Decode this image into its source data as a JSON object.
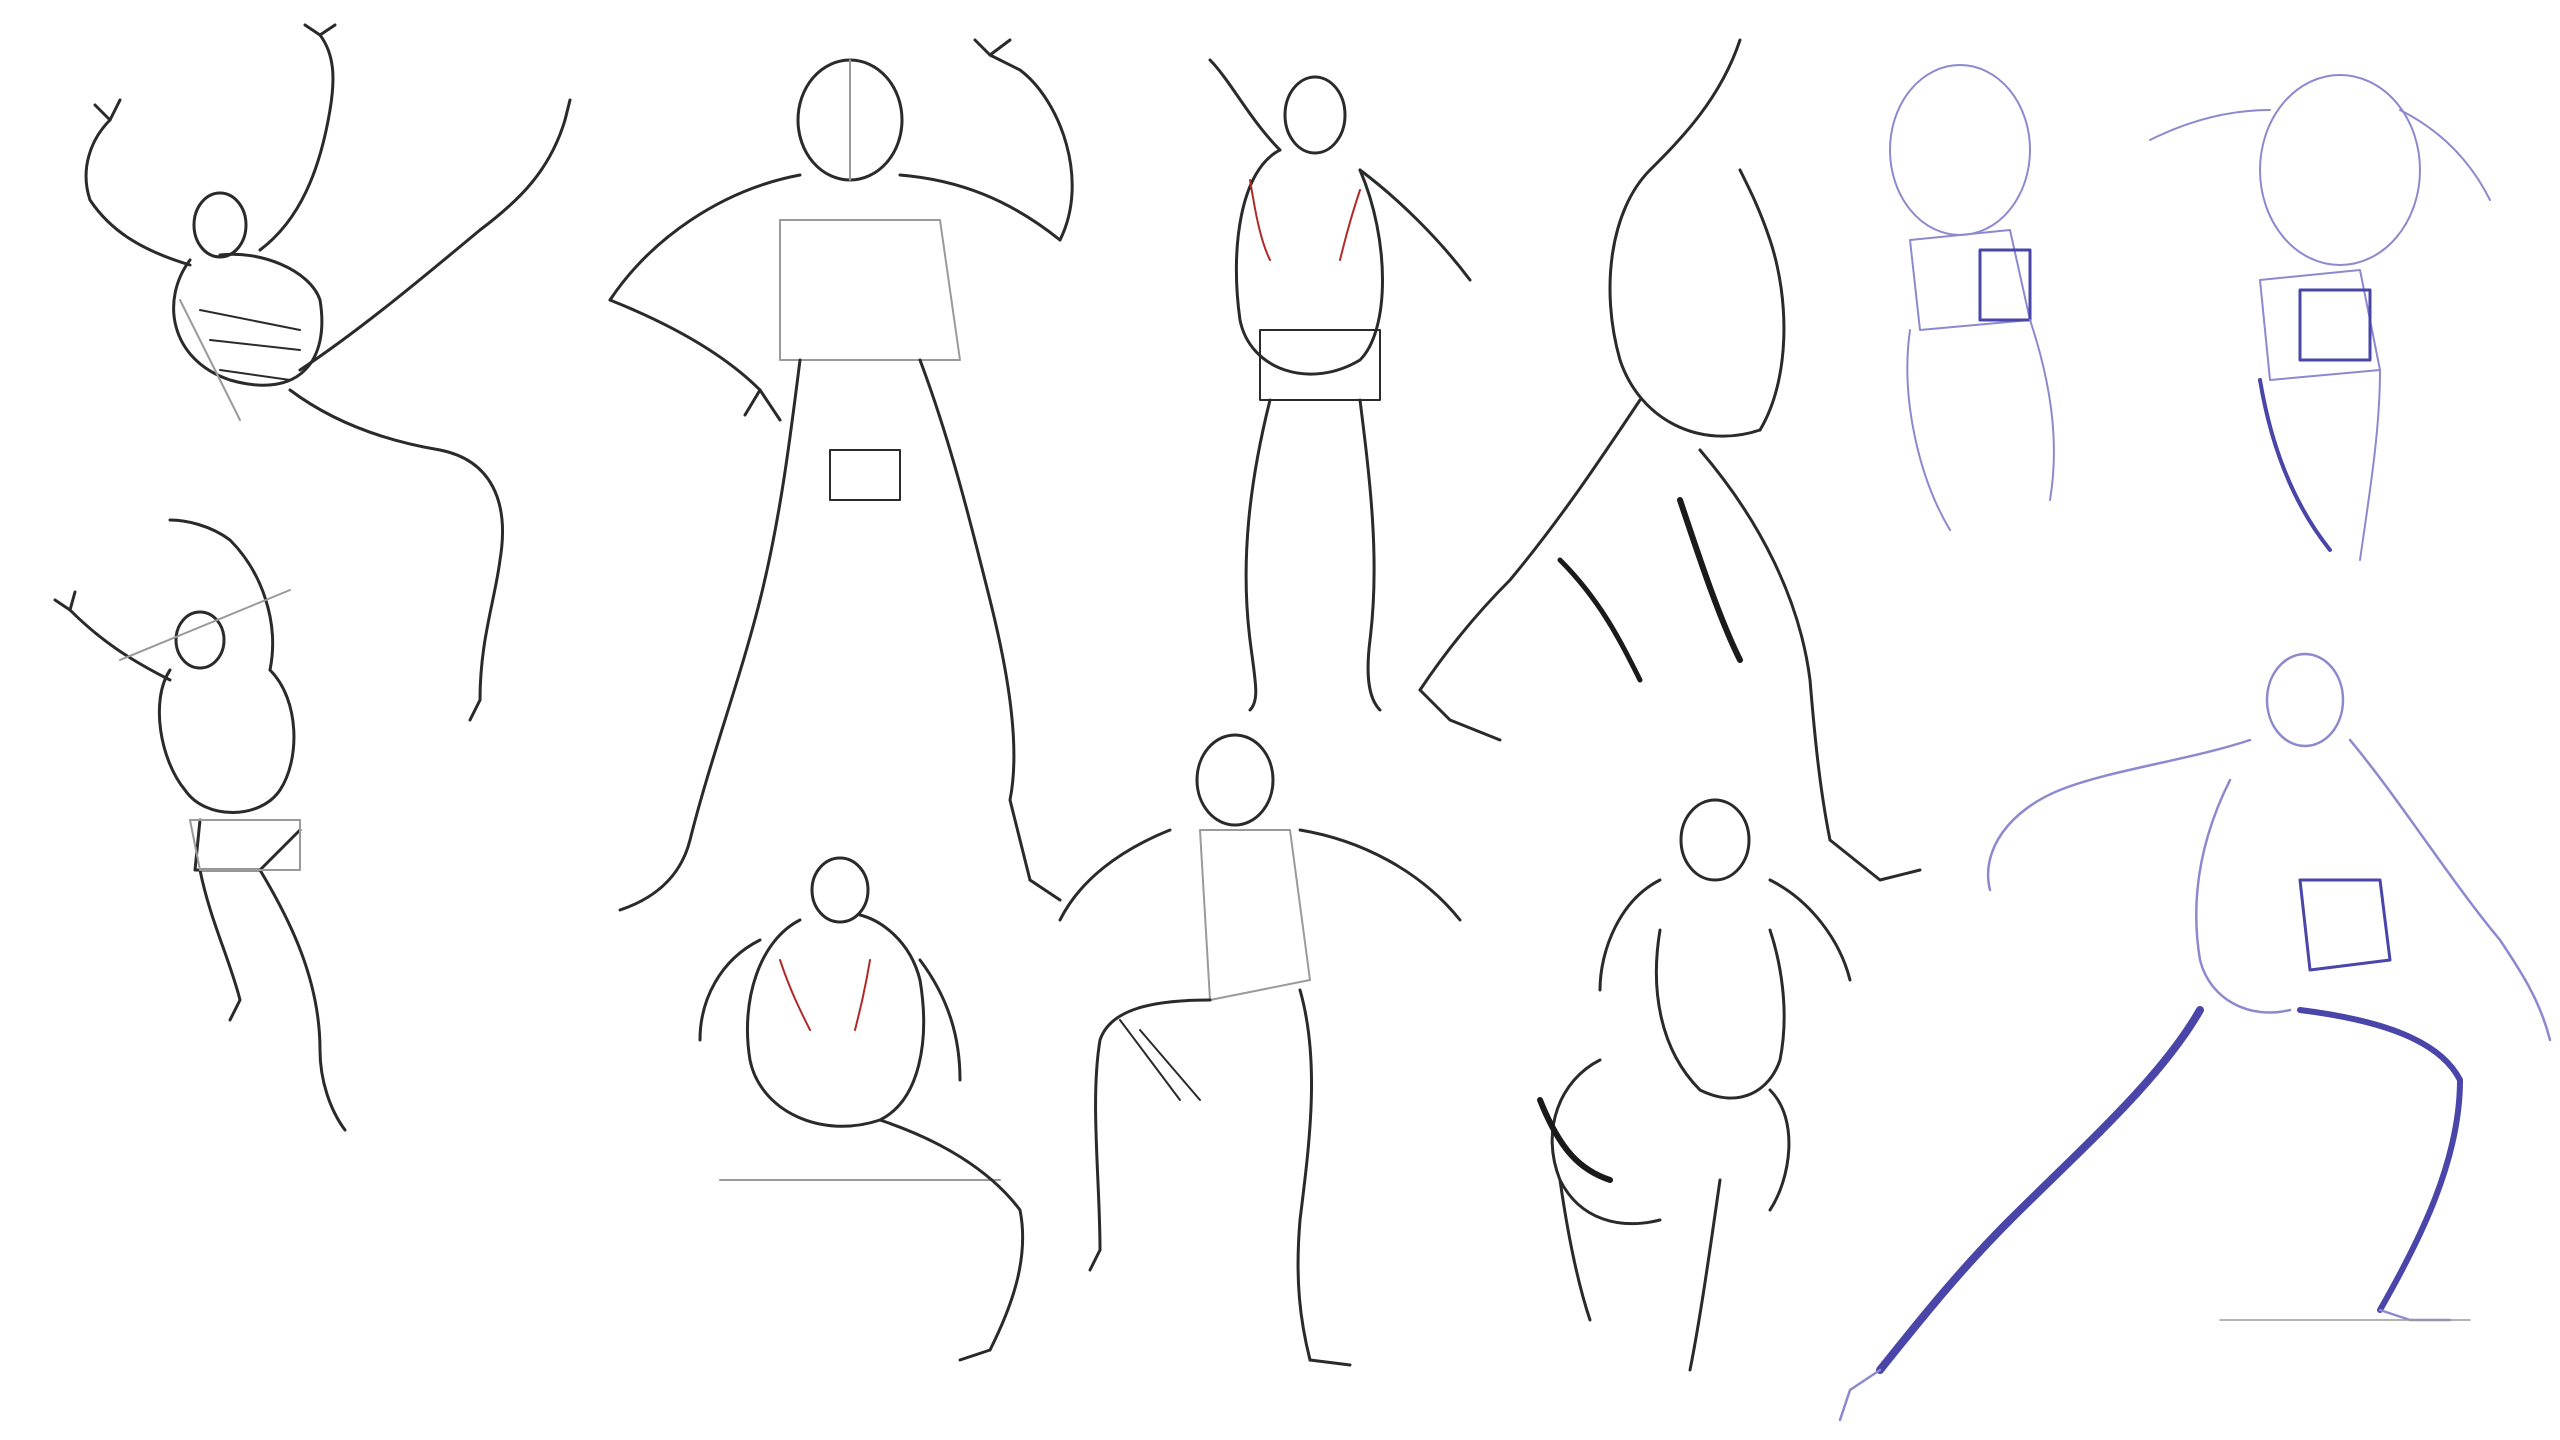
{
  "image": {
    "kind": "figure-drawing-study-sheet",
    "background_color": "#ffffff",
    "pencil_color": "#2a2a2a",
    "blue_pencil_color": "#4a45a8",
    "accent_red_color": "#b02a2a"
  }
}
